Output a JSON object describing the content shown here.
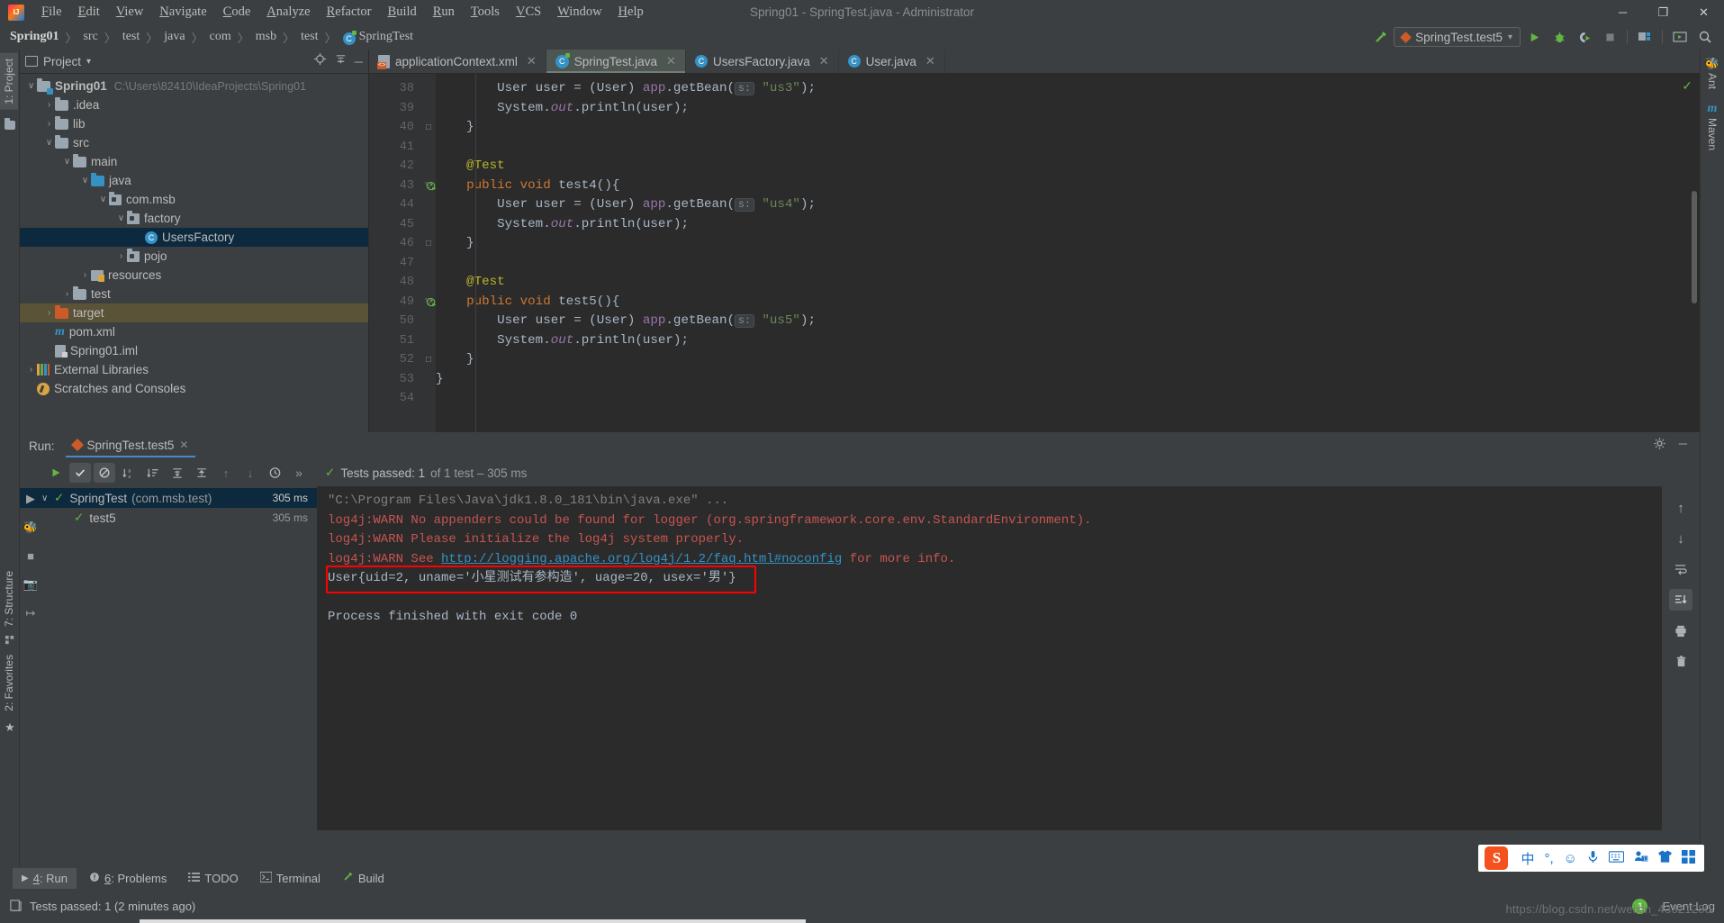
{
  "titlebar": {
    "logo_name": "intellij-logo",
    "menus": [
      "File",
      "Edit",
      "View",
      "Navigate",
      "Code",
      "Analyze",
      "Refactor",
      "Build",
      "Run",
      "Tools",
      "VCS",
      "Window",
      "Help"
    ],
    "window_title": "Spring01 - SpringTest.java - Administrator",
    "minimize": "─",
    "maximize": "❐",
    "close": "✕"
  },
  "navbar": {
    "crumbs": [
      "Spring01",
      "src",
      "test",
      "java",
      "com",
      "msb",
      "test",
      "SpringTest"
    ],
    "separator": "〉",
    "build_icon": "hammer-icon",
    "run_config": "SpringTest.test5",
    "dropdown_caret": "▾",
    "run_icon": "▶",
    "debug_icon": "debug-bug-icon",
    "coverage_icon": "run-with-coverage-icon",
    "stop_icon": "■",
    "project_structure_icon": "project-structure-icon",
    "updates_icon": "screen-icon",
    "search_icon": "⌕"
  },
  "left_stripe": {
    "project_tab": "1: Project",
    "structure_tab": "7: Structure",
    "favorites_tab": "2: Favorites"
  },
  "right_stripe": {
    "ant_tab": "Ant",
    "maven_tab": "Maven"
  },
  "project_panel": {
    "title": "Project",
    "caret": "▾",
    "locate_icon": "locate-icon",
    "collapse_icon": "collapse-all-icon",
    "hide_icon": "─",
    "tree": [
      {
        "label": "Spring01",
        "detail": "C:\\Users\\82410\\IdeaProjects\\Spring01",
        "indent": 0,
        "arrow": "∨",
        "icon": "module-folder",
        "bold": true,
        "state": "normal"
      },
      {
        "label": ".idea",
        "detail": "",
        "indent": 1,
        "arrow": "›",
        "icon": "folder-grey",
        "bold": false,
        "state": "normal"
      },
      {
        "label": "lib",
        "detail": "",
        "indent": 1,
        "arrow": "›",
        "icon": "folder-grey",
        "bold": false,
        "state": "normal"
      },
      {
        "label": "src",
        "detail": "",
        "indent": 1,
        "arrow": "∨",
        "icon": "folder-grey",
        "bold": false,
        "state": "normal"
      },
      {
        "label": "main",
        "detail": "",
        "indent": 2,
        "arrow": "∨",
        "icon": "folder-grey",
        "bold": false,
        "state": "normal"
      },
      {
        "label": "java",
        "detail": "",
        "indent": 3,
        "arrow": "∨",
        "icon": "folder-blue",
        "bold": false,
        "state": "normal"
      },
      {
        "label": "com.msb",
        "detail": "",
        "indent": 4,
        "arrow": "∨",
        "icon": "package",
        "bold": false,
        "state": "normal"
      },
      {
        "label": "factory",
        "detail": "",
        "indent": 5,
        "arrow": "∨",
        "icon": "package",
        "bold": false,
        "state": "normal"
      },
      {
        "label": "UsersFactory",
        "detail": "",
        "indent": 6,
        "arrow": "",
        "icon": "class",
        "bold": false,
        "state": "selected"
      },
      {
        "label": "pojo",
        "detail": "",
        "indent": 5,
        "arrow": "›",
        "icon": "package",
        "bold": false,
        "state": "normal"
      },
      {
        "label": "resources",
        "detail": "",
        "indent": 3,
        "arrow": "›",
        "icon": "resources",
        "bold": false,
        "state": "normal"
      },
      {
        "label": "test",
        "detail": "",
        "indent": 2,
        "arrow": "›",
        "icon": "folder-grey",
        "bold": false,
        "state": "normal"
      },
      {
        "label": "target",
        "detail": "",
        "indent": 1,
        "arrow": "›",
        "icon": "folder-orange",
        "bold": false,
        "state": "highlighted"
      },
      {
        "label": "pom.xml",
        "detail": "",
        "indent": 1,
        "arrow": "",
        "icon": "maven",
        "bold": false,
        "state": "normal"
      },
      {
        "label": "Spring01.iml",
        "detail": "",
        "indent": 1,
        "arrow": "",
        "icon": "iml",
        "bold": false,
        "state": "normal"
      },
      {
        "label": "External Libraries",
        "detail": "",
        "indent": 0,
        "arrow": "›",
        "icon": "libraries",
        "bold": false,
        "state": "normal"
      },
      {
        "label": "Scratches and Consoles",
        "detail": "",
        "indent": 0,
        "arrow": "",
        "icon": "scratches",
        "bold": false,
        "state": "normal"
      }
    ]
  },
  "editor": {
    "tabs": [
      {
        "label": "applicationContext.xml",
        "icon": "xml-file-icon",
        "active": false,
        "close": "✕"
      },
      {
        "label": "SpringTest.java",
        "icon": "spring-class-icon",
        "active": true,
        "close": "✕"
      },
      {
        "label": "UsersFactory.java",
        "icon": "java-class-icon",
        "active": false,
        "close": "✕"
      },
      {
        "label": "User.java",
        "icon": "java-class-icon",
        "active": false,
        "close": "✕"
      }
    ],
    "line_numbers": [
      "38",
      "39",
      "40",
      "41",
      "42",
      "43",
      "44",
      "45",
      "46",
      "47",
      "48",
      "49",
      "50",
      "51",
      "52",
      "53",
      "54"
    ],
    "lines": [
      {
        "n": "38",
        "segments": [
          {
            "t": "        User user = (User) ",
            "c": "pl"
          },
          {
            "t": "app",
            "c": "fld"
          },
          {
            "t": ".getBean(",
            "c": "pl"
          },
          {
            "t": "s:",
            "c": "hint"
          },
          {
            "t": " ",
            "c": "pl"
          },
          {
            "t": "\"us3\"",
            "c": "str"
          },
          {
            "t": ");",
            "c": "pl"
          }
        ]
      },
      {
        "n": "39",
        "segments": [
          {
            "t": "        System.",
            "c": "pl"
          },
          {
            "t": "out",
            "c": "ital"
          },
          {
            "t": ".println(user);",
            "c": "pl"
          }
        ]
      },
      {
        "n": "40",
        "segments": [
          {
            "t": "    }",
            "c": "pl"
          }
        ]
      },
      {
        "n": "41",
        "segments": [
          {
            "t": "",
            "c": "pl"
          }
        ]
      },
      {
        "n": "42",
        "segments": [
          {
            "t": "    @Test",
            "c": "ann"
          }
        ]
      },
      {
        "n": "43",
        "segments": [
          {
            "t": "    ",
            "c": "pl"
          },
          {
            "t": "public void ",
            "c": "kw"
          },
          {
            "t": "test4(){",
            "c": "pl"
          }
        ]
      },
      {
        "n": "44",
        "segments": [
          {
            "t": "        User user = (User) ",
            "c": "pl"
          },
          {
            "t": "app",
            "c": "fld"
          },
          {
            "t": ".getBean(",
            "c": "pl"
          },
          {
            "t": "s:",
            "c": "hint"
          },
          {
            "t": " ",
            "c": "pl"
          },
          {
            "t": "\"us4\"",
            "c": "str"
          },
          {
            "t": ");",
            "c": "pl"
          }
        ]
      },
      {
        "n": "45",
        "segments": [
          {
            "t": "        System.",
            "c": "pl"
          },
          {
            "t": "out",
            "c": "ital"
          },
          {
            "t": ".println(user);",
            "c": "pl"
          }
        ]
      },
      {
        "n": "46",
        "segments": [
          {
            "t": "    }",
            "c": "pl"
          }
        ]
      },
      {
        "n": "47",
        "segments": [
          {
            "t": "",
            "c": "pl"
          }
        ]
      },
      {
        "n": "48",
        "segments": [
          {
            "t": "    @Test",
            "c": "ann"
          }
        ]
      },
      {
        "n": "49",
        "segments": [
          {
            "t": "    ",
            "c": "pl"
          },
          {
            "t": "public void ",
            "c": "kw"
          },
          {
            "t": "test5(){",
            "c": "pl"
          }
        ]
      },
      {
        "n": "50",
        "segments": [
          {
            "t": "        User user = (User) ",
            "c": "pl"
          },
          {
            "t": "app",
            "c": "fld"
          },
          {
            "t": ".getBean(",
            "c": "pl"
          },
          {
            "t": "s:",
            "c": "hint"
          },
          {
            "t": " ",
            "c": "pl"
          },
          {
            "t": "\"us5\"",
            "c": "str"
          },
          {
            "t": ");",
            "c": "pl"
          }
        ]
      },
      {
        "n": "51",
        "segments": [
          {
            "t": "        System.",
            "c": "pl"
          },
          {
            "t": "out",
            "c": "ital"
          },
          {
            "t": ".println(user);",
            "c": "pl"
          }
        ]
      },
      {
        "n": "52",
        "segments": [
          {
            "t": "    }",
            "c": "pl"
          }
        ]
      },
      {
        "n": "53",
        "segments": [
          {
            "t": "}",
            "c": "pl"
          }
        ]
      },
      {
        "n": "54",
        "segments": [
          {
            "t": "",
            "c": "pl"
          }
        ]
      }
    ],
    "inspection_ok": "✓"
  },
  "run_window": {
    "label": "Run:",
    "tab_title": "SpringTest.test5",
    "tab_close": "✕",
    "settings_icon": "gear-icon",
    "hide_icon": "─",
    "toolbar": {
      "rerun": "▶",
      "show_passed": "✓",
      "ignore": "⊘",
      "sort_alpha": "sort-alphabetically-icon",
      "sort_duration": "sort-by-duration-icon",
      "expand_all": "expand-all-icon",
      "collapse_all": "collapse-all-icon",
      "prev_fail": "↑",
      "next_fail": "↓",
      "history": "history-icon",
      "more": "»"
    },
    "status_check": "✓",
    "status_bold": "Tests passed: 1",
    "status_rest": "of 1 test – 305 ms",
    "left_gutter": [
      "rerun-icon",
      "debug-icon",
      "stop-icon",
      "camera-icon",
      "export-icon"
    ],
    "tests": [
      {
        "label": "SpringTest",
        "pkg": "(com.msb.test)",
        "time": "305 ms",
        "indent": 0,
        "arrow": "∨",
        "selected": true
      },
      {
        "label": "test5",
        "pkg": "",
        "time": "305 ms",
        "indent": 1,
        "arrow": "",
        "selected": false
      }
    ],
    "console": [
      {
        "text": "\"C:\\Program Files\\Java\\jdk1.8.0_181\\bin\\java.exe\" ...",
        "cls": "c-grey"
      },
      {
        "text": "log4j:WARN No appenders could be found for logger (org.springframework.core.env.StandardEnvironment).",
        "cls": "c-red"
      },
      {
        "text": "log4j:WARN Please initialize the log4j system properly.",
        "cls": "c-red"
      },
      {
        "text": "log4j:WARN See ",
        "cls": "c-red",
        "link": "http://logging.apache.org/log4j/1.2/faq.html#noconfig",
        "after": " for more info."
      },
      {
        "text": "User{uid=2, uname='小星测试有参构造', uage=20, usex='男'}",
        "cls": "",
        "highlight": true
      },
      {
        "text": "",
        "cls": ""
      },
      {
        "text": "Process finished with exit code 0",
        "cls": ""
      }
    ],
    "right_gutter": [
      "↑",
      "↓",
      "soft-wrap-icon",
      "scroll-to-end-icon",
      "print-icon",
      "trash-icon"
    ],
    "highlight_color": "#ff0000"
  },
  "bottom_tabs": [
    {
      "num": "4",
      "label": "Run",
      "icon": "▶",
      "active": true
    },
    {
      "num": "6",
      "label": "Problems",
      "icon": "warning-icon",
      "active": false
    },
    {
      "num": "",
      "label": "TODO",
      "icon": "todo-list-icon",
      "active": false
    },
    {
      "num": "",
      "label": "Terminal",
      "icon": "terminal-icon",
      "active": false
    },
    {
      "num": "",
      "label": "Build",
      "icon": "hammer-icon",
      "active": false
    }
  ],
  "statusbar": {
    "icon": "memory-icon",
    "message": "Tests passed: 1 (2 minutes ago)",
    "event_count": "1",
    "event_log": "Event Log"
  },
  "ime": {
    "logo": "sogou-logo",
    "items": [
      "中",
      "°,",
      "☺",
      "microphone-icon",
      "keyboard-icon",
      "user-icon",
      "skin-icon",
      "apps-icon"
    ]
  },
  "watermark": "https://blog.csdn.net/weixin_43321280",
  "colors": {
    "accent_blue": "#3592c4",
    "green": "#62b543",
    "red": "#c75450",
    "highlight_red": "#ff0000",
    "selection": "#0d293e",
    "target_folder": "#5b5337"
  }
}
